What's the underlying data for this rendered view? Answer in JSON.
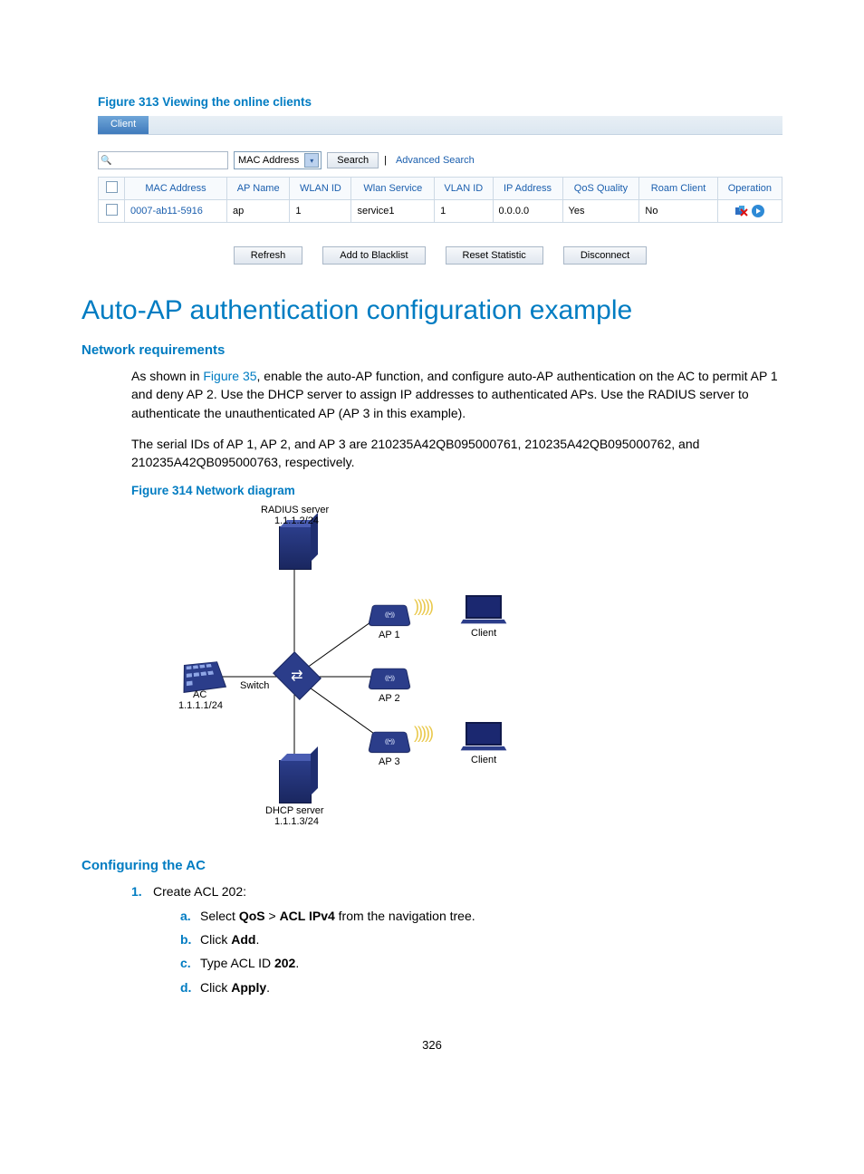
{
  "figure313": {
    "caption": "Figure 313 Viewing the online clients",
    "tab": "Client",
    "search_field_icon": "🔍",
    "select_label": "MAC Address",
    "search_btn": "Search",
    "adv_link": "Advanced Search",
    "headers": [
      "",
      "MAC Address",
      "AP Name",
      "WLAN ID",
      "Wlan Service",
      "VLAN ID",
      "IP Address",
      "QoS Quality",
      "Roam Client",
      "Operation"
    ],
    "row": {
      "mac": "0007-ab11-5916",
      "ap": "ap",
      "wlanid": "1",
      "service": "service1",
      "vlan": "1",
      "ip": "0.0.0.0",
      "qos": "Yes",
      "roam": "No"
    },
    "actions": [
      "Refresh",
      "Add to Blacklist",
      "Reset Statistic",
      "Disconnect"
    ]
  },
  "section_title": "Auto-AP authentication configuration example",
  "net_req_heading": "Network requirements",
  "para1a": "As shown in ",
  "figure35_link": "Figure 35",
  "para1b": ", enable the auto-AP function, and configure auto-AP authentication on the AC to permit AP 1 and deny AP 2. Use the DHCP server to assign IP addresses to authenticated APs. Use the RADIUS server to authenticate the unauthenticated AP (AP 3 in this example).",
  "para2": "The serial IDs of AP 1, AP 2, and AP 3 are 210235A42QB095000761, 210235A42QB095000762, and 210235A42QB095000763, respectively.",
  "figure314": {
    "caption": "Figure 314 Network diagram",
    "labels": {
      "radius": "RADIUS server",
      "radius_ip": "1.1.1.2/24",
      "ac": "AC",
      "ac_ip": "1.1.1.1/24",
      "switch": "Switch",
      "ap1": "AP 1",
      "ap2": "AP 2",
      "ap3": "AP 3",
      "client": "Client",
      "dhcp": "DHCP server",
      "dhcp_ip": "1.1.1.3/24"
    }
  },
  "config_heading": "Configuring the AC",
  "step1": "Create ACL 202:",
  "step1a_pre": "Select ",
  "step1a_b1": "QoS",
  "step1a_mid": " > ",
  "step1a_b2": "ACL IPv4",
  "step1a_post": " from the navigation tree.",
  "step1b_pre": "Click ",
  "step1b_b": "Add",
  "step1b_post": ".",
  "step1c_pre": "Type ACL ID ",
  "step1c_b": "202",
  "step1c_post": ".",
  "step1d_pre": "Click ",
  "step1d_b": "Apply",
  "step1d_post": ".",
  "page_num": "326"
}
